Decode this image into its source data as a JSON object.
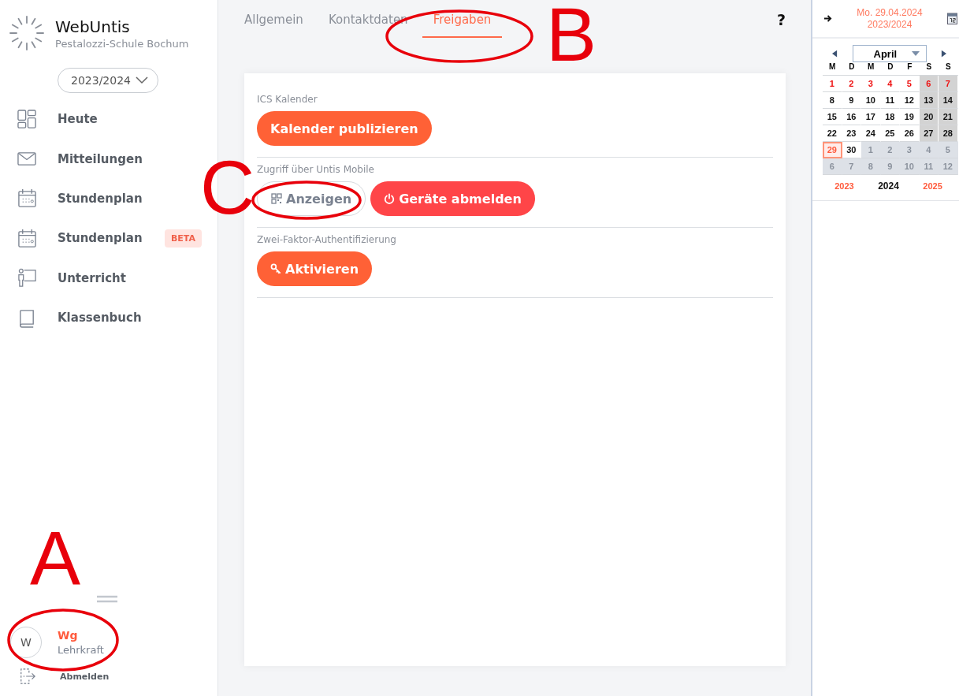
{
  "brand": {
    "name": "WebUntis",
    "school": "Pestalozzi-Schule Bochum"
  },
  "year_selector": {
    "value": "2023/2024"
  },
  "nav": [
    {
      "label": "Heute"
    },
    {
      "label": "Mitteilungen"
    },
    {
      "label": "Stundenplan"
    },
    {
      "label": "Stundenplan",
      "badge": "BETA"
    },
    {
      "label": "Unterricht"
    },
    {
      "label": "Klassenbuch"
    }
  ],
  "user": {
    "avatar": "W",
    "name": "Wg",
    "role": "Lehrkraft",
    "logout": "Abmelden"
  },
  "tabs": [
    {
      "label": "Allgemein",
      "selected": false
    },
    {
      "label": "Kontaktdaten",
      "selected": false
    },
    {
      "label": "Freigaben",
      "selected": true
    }
  ],
  "help": "?",
  "sections": [
    {
      "title": "ICS Kalender",
      "buttons": [
        {
          "label": "Kalender publizieren",
          "kind": "plain"
        }
      ]
    },
    {
      "title": "Zugriff über Untis Mobile",
      "buttons": [
        {
          "label": "Anzeigen",
          "kind": "qr"
        },
        {
          "label": "Geräte abmelden",
          "kind": "power"
        }
      ]
    },
    {
      "title": "Zwei-Faktor-Authentifizierung",
      "buttons": [
        {
          "label": "Aktivieren",
          "kind": "key"
        }
      ]
    }
  ],
  "calendar": {
    "date": "Mo. 29.04.2024",
    "school_year": "2023/2024",
    "month": "April",
    "weekdays": [
      "M",
      "D",
      "M",
      "D",
      "F",
      "S",
      "S"
    ],
    "weeks": [
      [
        {
          "day": "1",
          "kind": "holiday",
          "weekend": false,
          "selected": false
        },
        {
          "day": "2",
          "kind": "holiday",
          "weekend": false,
          "selected": false
        },
        {
          "day": "3",
          "kind": "holiday",
          "weekend": false,
          "selected": false
        },
        {
          "day": "4",
          "kind": "holiday",
          "weekend": false,
          "selected": false
        },
        {
          "day": "5",
          "kind": "holiday",
          "weekend": false,
          "selected": false
        },
        {
          "day": "6",
          "kind": "holiday",
          "weekend": true,
          "selected": false
        },
        {
          "day": "7",
          "kind": "holiday",
          "weekend": true,
          "selected": false
        }
      ],
      [
        {
          "day": "8",
          "kind": "normal",
          "weekend": false,
          "selected": false
        },
        {
          "day": "9",
          "kind": "normal",
          "weekend": false,
          "selected": false
        },
        {
          "day": "10",
          "kind": "normal",
          "weekend": false,
          "selected": false
        },
        {
          "day": "11",
          "kind": "normal",
          "weekend": false,
          "selected": false
        },
        {
          "day": "12",
          "kind": "normal",
          "weekend": false,
          "selected": false
        },
        {
          "day": "13",
          "kind": "normal",
          "weekend": true,
          "selected": false
        },
        {
          "day": "14",
          "kind": "normal",
          "weekend": true,
          "selected": false
        }
      ],
      [
        {
          "day": "15",
          "kind": "normal",
          "weekend": false,
          "selected": false
        },
        {
          "day": "16",
          "kind": "normal",
          "weekend": false,
          "selected": false
        },
        {
          "day": "17",
          "kind": "normal",
          "weekend": false,
          "selected": false
        },
        {
          "day": "18",
          "kind": "normal",
          "weekend": false,
          "selected": false
        },
        {
          "day": "19",
          "kind": "normal",
          "weekend": false,
          "selected": false
        },
        {
          "day": "20",
          "kind": "normal",
          "weekend": true,
          "selected": false
        },
        {
          "day": "21",
          "kind": "normal",
          "weekend": true,
          "selected": false
        }
      ],
      [
        {
          "day": "22",
          "kind": "normal",
          "weekend": false,
          "selected": false
        },
        {
          "day": "23",
          "kind": "normal",
          "weekend": false,
          "selected": false
        },
        {
          "day": "24",
          "kind": "normal",
          "weekend": false,
          "selected": false
        },
        {
          "day": "25",
          "kind": "normal",
          "weekend": false,
          "selected": false
        },
        {
          "day": "26",
          "kind": "normal",
          "weekend": false,
          "selected": false
        },
        {
          "day": "27",
          "kind": "normal",
          "weekend": true,
          "selected": false
        },
        {
          "day": "28",
          "kind": "normal",
          "weekend": true,
          "selected": false
        }
      ],
      [
        {
          "day": "29",
          "kind": "normal",
          "weekend": false,
          "selected": true
        },
        {
          "day": "30",
          "kind": "normal",
          "weekend": false,
          "selected": false
        },
        {
          "day": "1",
          "kind": "outside",
          "selected": false
        },
        {
          "day": "2",
          "kind": "outside",
          "selected": false
        },
        {
          "day": "3",
          "kind": "outside",
          "selected": false
        },
        {
          "day": "4",
          "kind": "outside",
          "selected": false
        },
        {
          "day": "5",
          "kind": "outside",
          "selected": false
        }
      ],
      [
        {
          "day": "6",
          "kind": "outside",
          "selected": false
        },
        {
          "day": "7",
          "kind": "outside",
          "selected": false
        },
        {
          "day": "8",
          "kind": "outside",
          "selected": false
        },
        {
          "day": "9",
          "kind": "outside",
          "selected": false
        },
        {
          "day": "10",
          "kind": "outside",
          "selected": false
        },
        {
          "day": "11",
          "kind": "outside",
          "selected": false
        },
        {
          "day": "12",
          "kind": "outside",
          "selected": false
        }
      ]
    ],
    "years": [
      {
        "label": "2023",
        "selected": false
      },
      {
        "label": "2024",
        "selected": true
      },
      {
        "label": "2025",
        "selected": false
      }
    ]
  },
  "annotations": [
    {
      "letter": "A"
    },
    {
      "letter": "B"
    },
    {
      "letter": "C"
    }
  ]
}
